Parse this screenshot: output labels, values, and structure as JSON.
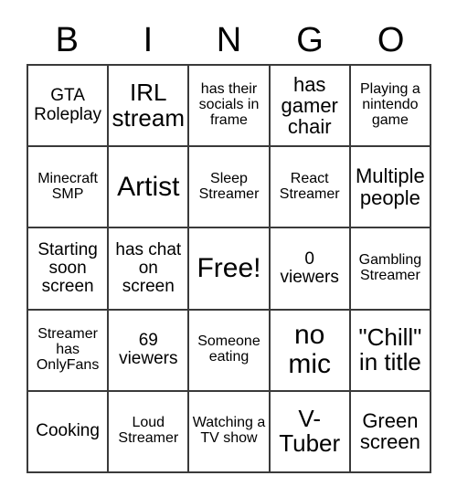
{
  "card": {
    "type": "bingo-card",
    "columns": 5,
    "rows": 5,
    "header": {
      "letters": [
        "B",
        "I",
        "N",
        "G",
        "O"
      ]
    },
    "colors": {
      "background": "#ffffff",
      "border": "#3a3a3a",
      "text": "#000000"
    },
    "cells": [
      {
        "text": "GTA Roleplay",
        "size": "md",
        "free": false
      },
      {
        "text": "IRL stream",
        "size": "xl",
        "free": false
      },
      {
        "text": "has their socials in frame",
        "size": "sm",
        "free": false
      },
      {
        "text": "has gamer chair",
        "size": "lg",
        "free": false
      },
      {
        "text": "Playing a nintendo game",
        "size": "sm",
        "free": false
      },
      {
        "text": "Minecraft SMP",
        "size": "sm",
        "free": false
      },
      {
        "text": "Artist",
        "size": "xxl",
        "free": false
      },
      {
        "text": "Sleep Streamer",
        "size": "sm",
        "free": false
      },
      {
        "text": "React Streamer",
        "size": "sm",
        "free": false
      },
      {
        "text": "Multiple people",
        "size": "lg",
        "free": false
      },
      {
        "text": "Starting soon screen",
        "size": "md",
        "free": false
      },
      {
        "text": "has chat on screen",
        "size": "md",
        "free": false
      },
      {
        "text": "Free!",
        "size": "xxl",
        "free": true
      },
      {
        "text": "0 viewers",
        "size": "md",
        "free": false
      },
      {
        "text": "Gambling Streamer",
        "size": "sm",
        "free": false
      },
      {
        "text": "Streamer has OnlyFans",
        "size": "sm",
        "free": false
      },
      {
        "text": "69 viewers",
        "size": "md",
        "free": false
      },
      {
        "text": "Someone eating",
        "size": "sm",
        "free": false
      },
      {
        "text": "no mic",
        "size": "xxl",
        "free": false
      },
      {
        "text": "\"Chill\" in title",
        "size": "xl",
        "free": false
      },
      {
        "text": "Cooking",
        "size": "md",
        "free": false
      },
      {
        "text": "Loud Streamer",
        "size": "sm",
        "free": false
      },
      {
        "text": "Watching a TV show",
        "size": "sm",
        "free": false
      },
      {
        "text": "V-Tuber",
        "size": "xl",
        "free": false
      },
      {
        "text": "Green screen",
        "size": "lg",
        "free": false
      }
    ]
  }
}
